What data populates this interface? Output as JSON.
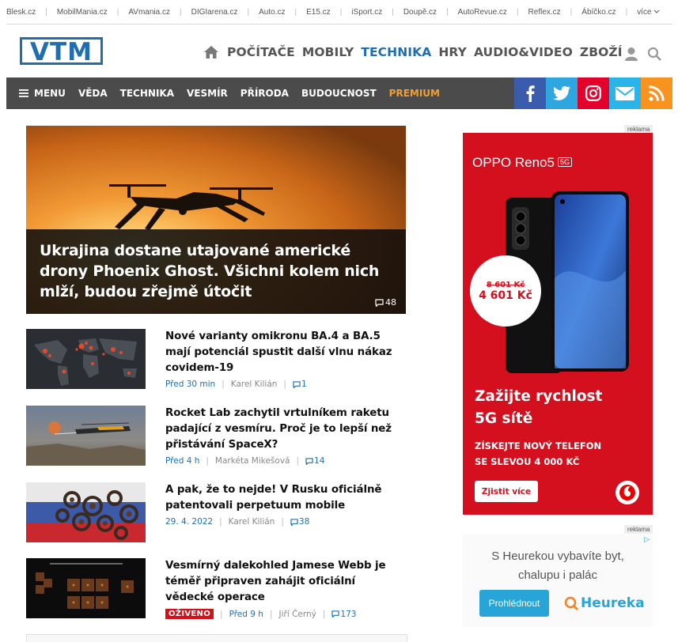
{
  "portal_links": [
    "Blesk.cz",
    "MobilMania.cz",
    "AVmania.cz",
    "DIGIarena.cz",
    "Auto.cz",
    "E15.cz",
    "iSport.cz",
    "Doupě.cz",
    "AutoRevue.cz",
    "Reflex.cz",
    "Ábíčko.cz"
  ],
  "portal_more": "více",
  "logo_text": "VTM",
  "main_nav": [
    {
      "label": "POČÍTAČE"
    },
    {
      "label": "MOBILY"
    },
    {
      "label": "TECHNIKA"
    },
    {
      "label": "HRY"
    },
    {
      "label": "AUDIO&VIDEO"
    },
    {
      "label": "ZBOŽÍ"
    }
  ],
  "section_menu_label": "MENU",
  "section_nav": [
    "VĚDA",
    "TECHNIKA",
    "VESMÍR",
    "PŘÍRODA",
    "BUDOUCNOST",
    "PREMIUM"
  ],
  "colors": {
    "brand_blue": "#1f6fb0",
    "facebook": "#3b5cad",
    "twitter": "#2ea6e0",
    "instagram": "#e3002b",
    "mail": "#2ab4e8",
    "rss": "#f7931e"
  },
  "hero": {
    "title": "Ukrajina dostane utajované americké drony Phoenix Ghost. Všichni kolem nich mlží, budou zřejmě útočit",
    "comments": "48"
  },
  "articles": [
    {
      "title": "Nové varianty omikronu BA.4 a BA.5 mají potenciál spustit další vlnu nákaz covidem-19",
      "time": "Před 30 min",
      "author": "Karel Kilián",
      "comments": "1"
    },
    {
      "title": "Rocket Lab zachytil vrtulníkem raketu padající z vesmíru. Proč je to lepší než přistávání SpaceX?",
      "time": "Před 4 h",
      "author": "Markéta Mikešová",
      "comments": "14"
    },
    {
      "title": "A pak, že to nejde! V Rusku oficiálně patentovali perpetuum mobile",
      "time": "29. 4. 2022",
      "author": "Karel Kilián",
      "comments": "38"
    },
    {
      "title": "Vesmírný dalekohled Jamese Webb je téměř připraven zahájit oficiální vědecké operace",
      "live": "OŽIVENO",
      "time": "Před 9 h",
      "author": "Jiří Černý",
      "comments": "173"
    }
  ],
  "ad_label": "reklama",
  "ad1": {
    "brand": "OPPO Reno5",
    "badge": "5G",
    "old_price": "8 601 Kč",
    "new_price": "4 601 Kč",
    "headline_1": "Zažijte rychlost",
    "headline_2": "5G sítě",
    "sub_1": "ZÍSKEJTE NOVÝ TELEFON",
    "sub_2": "SE SLEVOU 4 000 KČ",
    "cta": "Zjistit více"
  },
  "ad2": {
    "text_1": "S Heurekou vybavíte byt,",
    "text_2": "chalupu i palác",
    "button": "Prohlédnout",
    "brand": "Heureka"
  }
}
